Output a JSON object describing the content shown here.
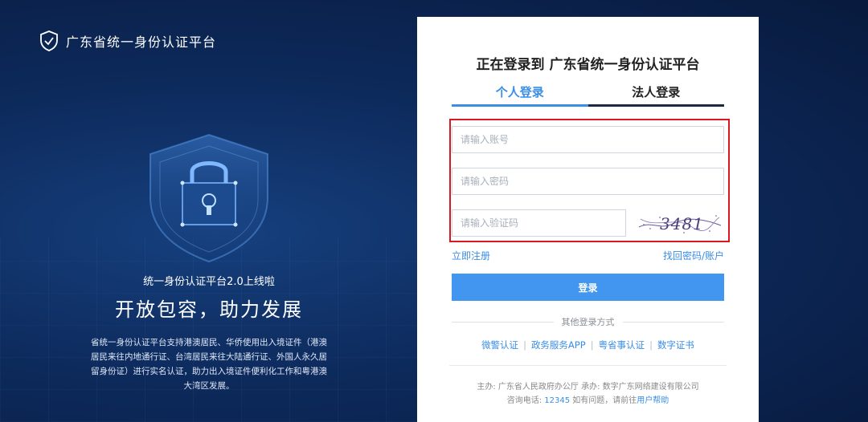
{
  "brand": {
    "title": "广东省统一身份认证平台",
    "icon": "shield-check-icon"
  },
  "hero": {
    "announcement": "统一身份认证平台2.0上线啦",
    "slogan": "开放包容，助力发展",
    "description": "省统一身份认证平台支持港澳居民、华侨使用出入境证件（港澳居民来往内地通行证、台湾居民来往大陆通行证、外国人永久居留身份证）进行实名认证，助力出入境证件便利化工作和粤港澳大湾区发展。"
  },
  "login": {
    "heading": "正在登录到 广东省统一身份认证平台",
    "tabs": [
      {
        "label": "个人登录",
        "active": true
      },
      {
        "label": "法人登录",
        "active": false
      }
    ],
    "account_placeholder": "请输入账号",
    "password_placeholder": "请输入密码",
    "captcha_placeholder": "请输入验证码",
    "captcha_text": "3481",
    "register_link": "立即注册",
    "recover_link": "找回密码/账户",
    "submit_label": "登录",
    "other_title": "其他登录方式",
    "other_methods": [
      "微警认证",
      "政务服务APP",
      "粤省事认证",
      "数字证书"
    ],
    "footer": {
      "sponsor": "主办: 广东省人民政府办公厅   承办: 数字广东网络建设有限公司",
      "hotline_label": "咨询电话:",
      "hotline": "12345",
      "help_prefix": "如有问题，请前往",
      "help_link": "用户帮助"
    }
  },
  "colors": {
    "accent": "#4296f0",
    "highlight_border": "#d9191f",
    "background": "#0d2a5c"
  }
}
